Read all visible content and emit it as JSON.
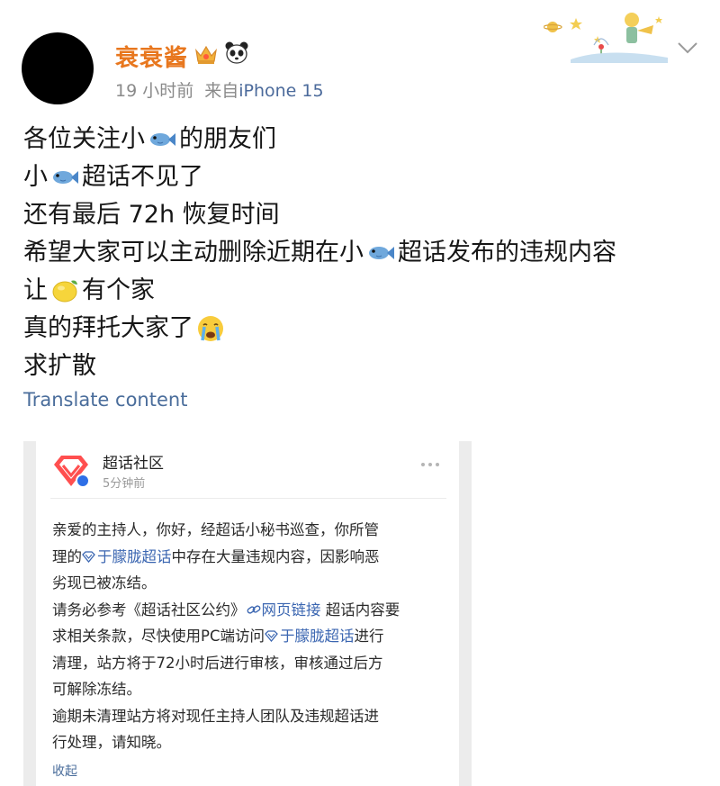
{
  "post": {
    "author": {
      "name": "衰衰酱",
      "badges": [
        "crown-badge-icon",
        "panda-badge-icon"
      ]
    },
    "time": "19 小时前",
    "source_prefix": "来自",
    "device": "iPhone 15",
    "lines": [
      [
        "各位关注小",
        {
          "icon": "fish-icon"
        },
        "的朋友们"
      ],
      [
        "小",
        {
          "icon": "fish-icon"
        },
        "超话不见了"
      ],
      [
        "还有最后 72h 恢复时间"
      ],
      [
        "希望大家可以主动删除近期在小",
        {
          "icon": "fish-icon"
        },
        "超话发布的违规内容"
      ],
      [
        "让",
        {
          "icon": "lemon-icon"
        },
        "有个家"
      ],
      [
        "真的拜托大家了",
        {
          "icon": "crying-face-icon"
        }
      ],
      [
        "求扩散"
      ]
    ],
    "translate_label": "Translate content"
  },
  "card": {
    "account_name": "超话社区",
    "time": "5分钟前",
    "body": [
      [
        {
          "t": "亲爱的主持人，你好，经超话小秘书巡查，你所管"
        }
      ],
      [
        {
          "t": "理的"
        },
        {
          "gem": true
        },
        {
          "t": "于朦胧超话",
          "link": true
        },
        {
          "t": "中存在大量违规内容，因影响恶"
        }
      ],
      [
        {
          "t": "劣现已被冻结。"
        }
      ],
      [
        {
          "t": "请务必参考《超话社区公约》"
        },
        {
          "chain": true
        },
        {
          "t": "网页链接",
          "link": true
        },
        {
          "t": " 超话内容要"
        }
      ],
      [
        {
          "t": "求相关条款，尽快使用PC端访问"
        },
        {
          "gem": true
        },
        {
          "t": "于朦胧超话",
          "link": true
        },
        {
          "t": "进行"
        }
      ],
      [
        {
          "t": "清理，站方将于72小时后进行审核，审核通过后方"
        }
      ],
      [
        {
          "t": "可解除冻结。"
        }
      ],
      [
        {
          "t": "逾期未清理站方将对现任主持人团队及违规超话进"
        }
      ],
      [
        {
          "t": "行处理，请知晓。"
        }
      ]
    ],
    "collapse_label": "收起"
  },
  "colors": {
    "username": "#e8771e",
    "link": "#4a6d9b",
    "card_link": "#3b66b1"
  }
}
